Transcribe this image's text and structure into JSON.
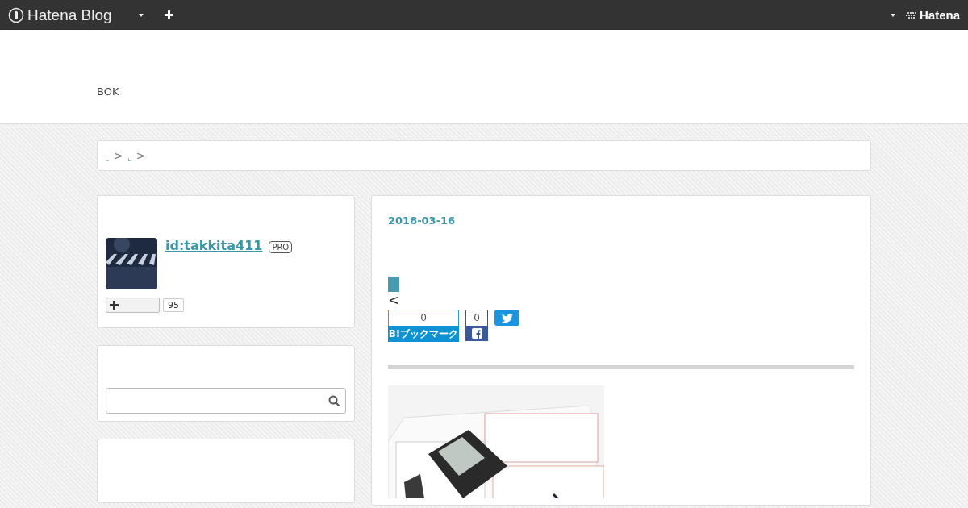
{
  "header": {
    "logo": "Hatena Blog",
    "brand": "Hatena"
  },
  "blog_title": "BOK",
  "breadcrumb": [
    ">",
    ">"
  ],
  "profile": {
    "id": "id:takkita411",
    "badge": "PRO",
    "subscribers": "95"
  },
  "entry": {
    "date": "2018-03-16",
    "prev": "<",
    "bookmark": {
      "count": "0",
      "label": "B!ブックマーク"
    },
    "facebook": {
      "count": "0"
    }
  }
}
